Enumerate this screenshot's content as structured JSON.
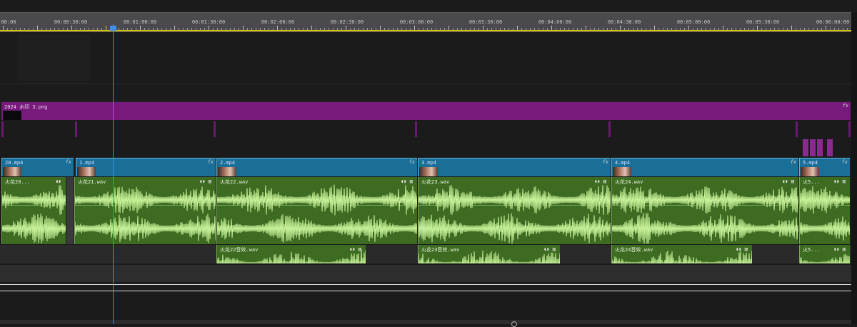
{
  "ruler": {
    "start_label": "00:00",
    "labels": [
      "00:00:30:00",
      "00:01:00:00",
      "00:01:30:00",
      "00:02:00:00",
      "00:02:30:00",
      "00:03:00:00",
      "00:03:30:00",
      "00:04:00:00",
      "00:04:30:00",
      "00:05:00:00",
      "00:05:30:00",
      "00:06:00:00"
    ]
  },
  "overlay_track": {
    "clip_name": "2024 水印 3.png",
    "fx": "fx"
  },
  "video_clips": [
    {
      "name": "20.mp4",
      "fx": "fx"
    },
    {
      "name": "1.mp4",
      "fx": "fx"
    },
    {
      "name": "2.mp4",
      "fx": "fx"
    },
    {
      "name": "3.mp4",
      "fx": "fx"
    },
    {
      "name": "4.mp4",
      "fx": "fx"
    },
    {
      "name": "5.mp4",
      "fx": "fx"
    }
  ],
  "audio_clips": [
    {
      "name": "火花20...",
      "icons": "◖◗"
    },
    {
      "name": "火花21.wav",
      "icons": "◖◗ ▥"
    },
    {
      "name": "火花22.wav",
      "icons": "◖◗ ▥"
    },
    {
      "name": "火花23.wav",
      "icons": "◖◗ ▥"
    },
    {
      "name": "火花24.wav",
      "icons": "◖◗ ▥"
    },
    {
      "name": "火5...",
      "icons": "◖◗ ▥"
    }
  ],
  "audio2_clips": [
    {
      "name": "火花22音效.wav",
      "icons": "◖◗ ▥"
    },
    {
      "name": "火花23音效.wav",
      "icons": "◖◗ ▥"
    },
    {
      "name": "火花24音效.wav",
      "icons": "◖◗ ▥"
    },
    {
      "name": "火5...",
      "icons": "◖◗ ▥"
    }
  ],
  "colors": {
    "video": "#1a6f99",
    "audio": "#3e6b22",
    "overlay": "#761b7b",
    "playhead": "#3f8fe8",
    "ruler_marker": "#d8c21a"
  }
}
